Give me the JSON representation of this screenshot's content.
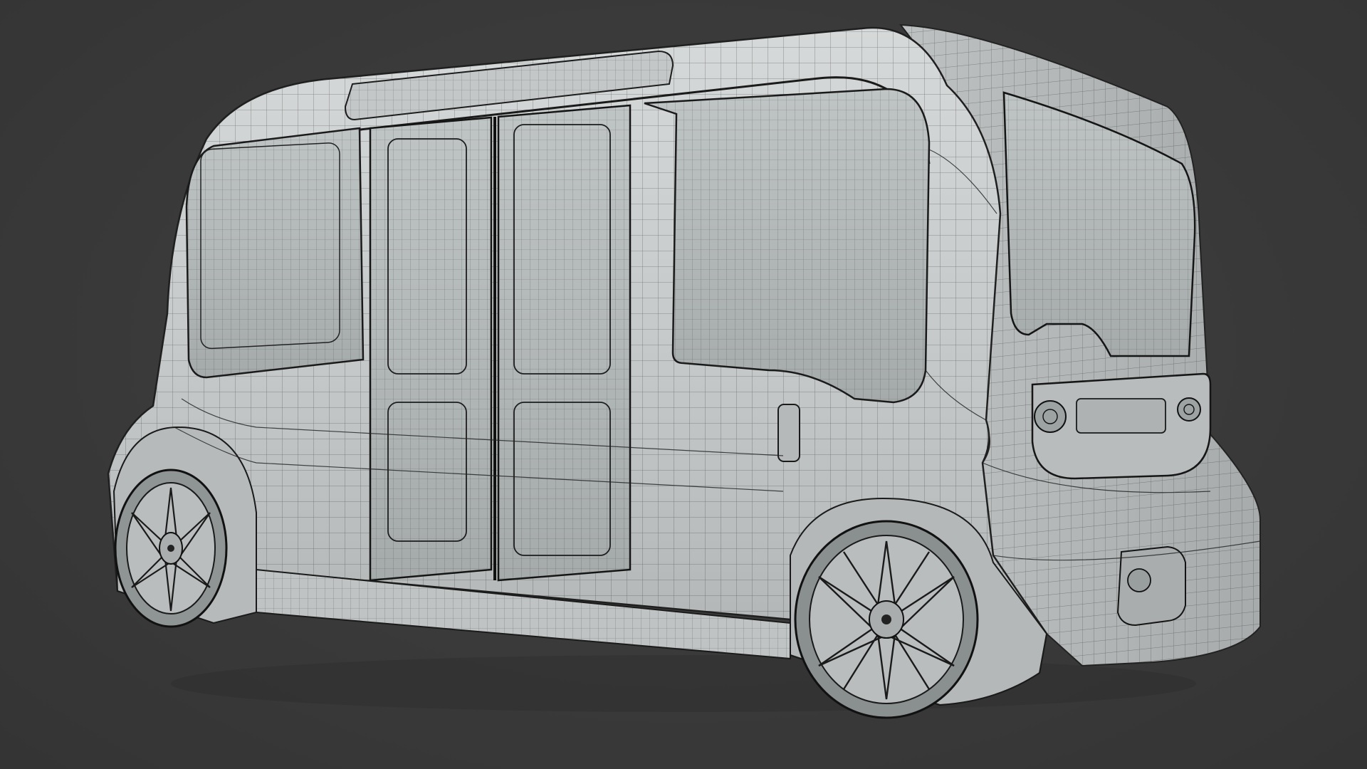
{
  "viewport": {
    "background_color": "#3a3a3a",
    "model_base_color": "#c9cccc",
    "model_shade_color": "#a9adad",
    "glass_color": "#b3b8b8",
    "wire_color": "#2a2a2a"
  },
  "model": {
    "display": "wireframe-on-shaded",
    "components": [
      "body-shell",
      "roof-light-bar",
      "front-side-window",
      "sliding-door-left",
      "sliding-door-right",
      "rear-side-window",
      "rear-glass",
      "rear-light-strip",
      "front-wheel",
      "rear-wheel",
      "rear-bumper-light"
    ]
  }
}
